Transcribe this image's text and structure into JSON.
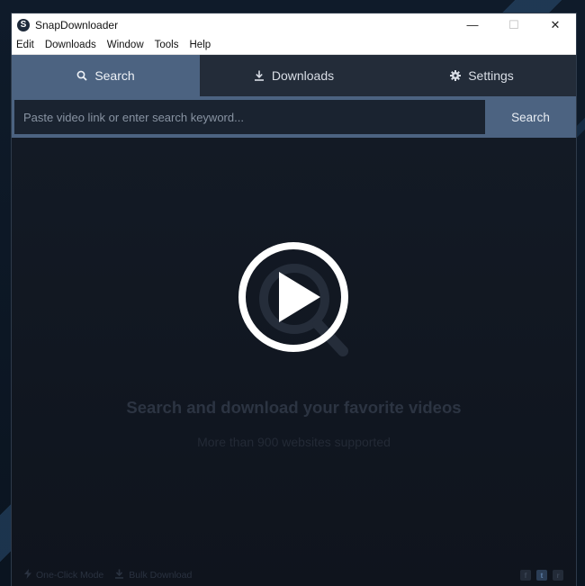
{
  "window": {
    "title": "SnapDownloader",
    "logo_letter": "S",
    "controls": {
      "minimize": "—",
      "maximize": "☐",
      "close": "✕"
    }
  },
  "menubar": {
    "items": [
      "Edit",
      "Downloads",
      "Window",
      "Tools",
      "Help"
    ]
  },
  "tabs": [
    {
      "label": "Search",
      "icon": "search-icon",
      "active": true
    },
    {
      "label": "Downloads",
      "icon": "download-icon",
      "active": false
    },
    {
      "label": "Settings",
      "icon": "gear-icon",
      "active": false
    }
  ],
  "search": {
    "placeholder": "Paste video link or enter search keyword...",
    "value": "",
    "button_label": "Search"
  },
  "empty_state": {
    "title": "Search and download your favorite videos",
    "subtitle": "More than 900 websites supported",
    "icon": "magnifier-icon"
  },
  "overlay": {
    "icon": "play-icon"
  },
  "footer": {
    "one_click_label": "One-Click Mode",
    "bulk_label": "Bulk Download",
    "social": [
      {
        "icon": "facebook-icon",
        "glyph": "f"
      },
      {
        "icon": "twitter-icon",
        "glyph": "t"
      },
      {
        "icon": "reddit-icon",
        "glyph": "r"
      }
    ]
  },
  "colors": {
    "accent": "#4c6381",
    "tab_bar": "#232c39",
    "content_bg": "#131a25"
  }
}
